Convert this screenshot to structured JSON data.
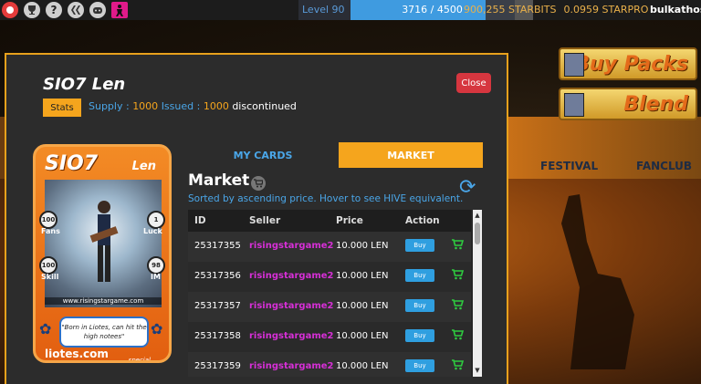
{
  "topbar": {
    "icons": [
      "alert-icon",
      "trophy-icon",
      "help-icon",
      "hive-icon",
      "discord-icon",
      "profile-icon"
    ],
    "help_glyph": "?",
    "level_label": "Level 90",
    "xp_text": "3716 / 4500",
    "xp_progress": 0.826,
    "starbits": "900,255 STARBITS",
    "starpro": "0.0959 STARPRO",
    "username": "bulkathos"
  },
  "background": {
    "nav": [
      "FESTIVAL",
      "FANCLUB"
    ],
    "buy_packs": "Buy Packs",
    "blend": "Blend"
  },
  "modal": {
    "title": "SIO7 Len",
    "stats_label": "Stats",
    "supply_label": "Supply :",
    "supply_value": "1000",
    "issued_label": "Issued :",
    "issued_value": "1000",
    "status": "discontinued",
    "close_label": "Close"
  },
  "card": {
    "name_left": "SIO7",
    "name_right": "Len",
    "url": "www.risingstargame.com",
    "quote": "\"Born in Liotes, can hit the high notees\"",
    "footer": "liotes.com",
    "special": "special",
    "stats": [
      {
        "value": "100",
        "label": "Fans"
      },
      {
        "value": "1",
        "label": "Luck"
      },
      {
        "value": "100",
        "label": "Skill"
      },
      {
        "value": "98",
        "label": "IM"
      }
    ]
  },
  "tabs": {
    "my_cards": "MY CARDS",
    "market": "MARKET"
  },
  "market": {
    "title": "Market",
    "sort_note": "Sorted by ascending price. Hover to see HIVE equivalent.",
    "columns": [
      "ID",
      "Seller",
      "Price",
      "Action"
    ],
    "rows": [
      {
        "id": "25317355",
        "seller": "risingstargame2",
        "price": "10.000 LEN",
        "buy": "Buy"
      },
      {
        "id": "25317356",
        "seller": "risingstargame2",
        "price": "10.000 LEN",
        "buy": "Buy"
      },
      {
        "id": "25317357",
        "seller": "risingstargame2",
        "price": "10.000 LEN",
        "buy": "Buy"
      },
      {
        "id": "25317358",
        "seller": "risingstargame2",
        "price": "10.000 LEN",
        "buy": "Buy"
      },
      {
        "id": "25317359",
        "seller": "risingstargame2",
        "price": "10.000 LEN",
        "buy": "Buy"
      }
    ]
  },
  "colors": {
    "accent_orange": "#f5a51d",
    "link_blue": "#4aa6e8",
    "seller_magenta": "#d62fd6",
    "close_red": "#d6363f"
  }
}
